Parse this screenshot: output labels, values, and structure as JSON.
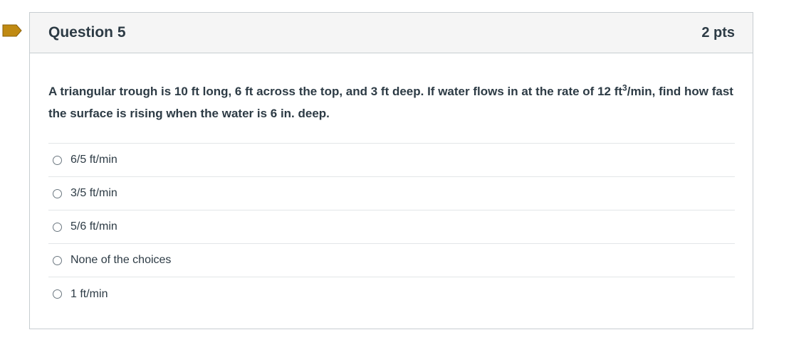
{
  "question": {
    "title": "Question 5",
    "points": "2 pts",
    "text_prefix": "A triangular trough is 10 ft long, 6 ft across the top, and 3 ft deep. If water flows in at the rate of 12 ft",
    "text_sup": "3",
    "text_suffix": "/min, find how fast the surface is rising when the water is 6 in. deep.",
    "answers": [
      {
        "label": "6/5 ft/min"
      },
      {
        "label": "3/5 ft/min"
      },
      {
        "label": "5/6 ft/min"
      },
      {
        "label": "None of the choices"
      },
      {
        "label": "1 ft/min"
      }
    ]
  },
  "colors": {
    "flag": "#c08a12",
    "header_bg": "#f5f5f5",
    "border": "#c7cdd1",
    "text": "#2d3b45"
  },
  "icons": {
    "flag": "flag-icon"
  }
}
